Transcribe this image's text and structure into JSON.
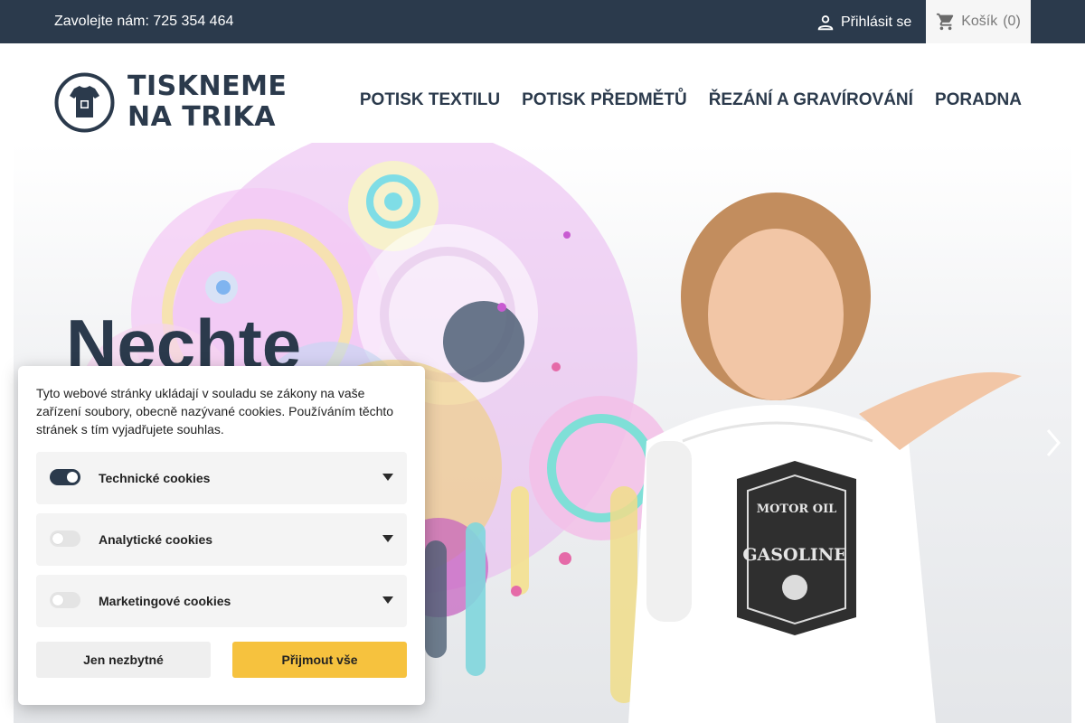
{
  "topbar": {
    "contact": "Zavolejte nám: 725 354 464",
    "login_icon": "person-icon",
    "login_label": "Přihlásit se",
    "cart_icon": "shopping-cart-icon",
    "cart_label": "Košík",
    "cart_count": "(0)"
  },
  "header": {
    "logo_icon": "t-shirt-badge-icon",
    "logo_line1": "TISKNEME",
    "logo_line2": "NA TRIKA",
    "nav": [
      {
        "label": "POTISK TEXTILU"
      },
      {
        "label": "POTISK PŘEDMĚTŮ"
      },
      {
        "label": "ŘEZÁNÍ A GRAVÍROVÁNÍ"
      },
      {
        "label": "PORADNA"
      }
    ]
  },
  "hero": {
    "title": "Nechte",
    "next_icon": "chevron-right-icon",
    "image_alt": "woman-in-printed-t-shirt"
  },
  "cookie": {
    "text": "Tyto webové stránky ukládají v souladu se zákony na vaše zařízení soubory, obecně nazývané cookies. Používáním těchto stránek s tím vyjadřujete souhlas.",
    "items": [
      {
        "label": "Technické cookies",
        "enabled": true
      },
      {
        "label": "Analytické cookies",
        "enabled": false
      },
      {
        "label": "Marketingové cookies",
        "enabled": false
      }
    ],
    "btn_essential": "Jen nezbytné",
    "btn_accept": "Přijmout vše"
  },
  "colors": {
    "brand_dark": "#2b3a4c",
    "accept_yellow": "#f6c23e"
  }
}
